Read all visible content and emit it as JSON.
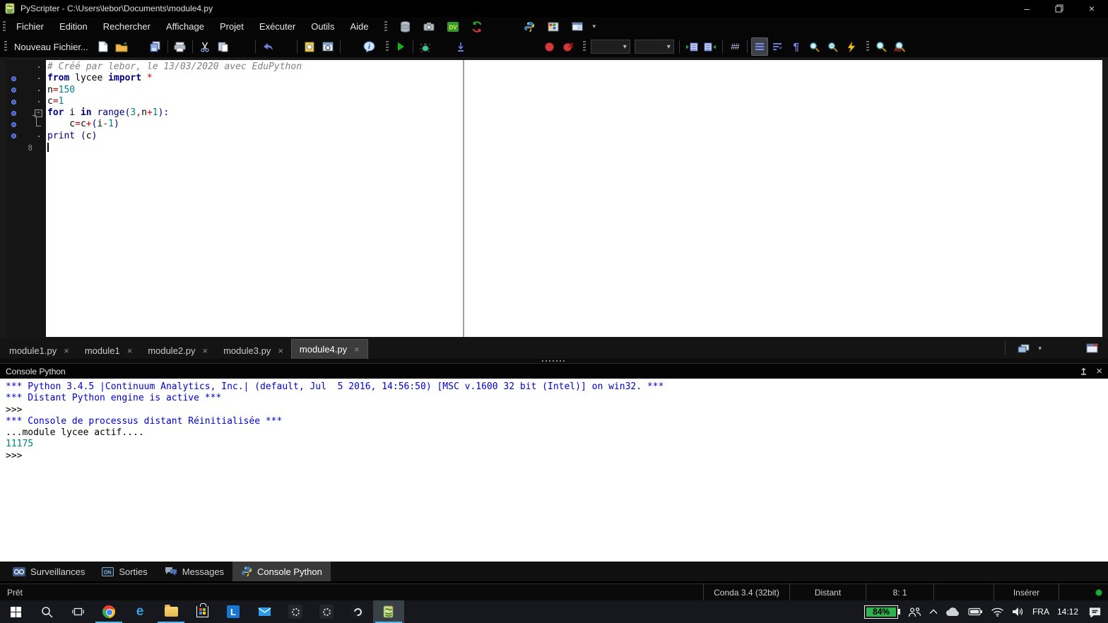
{
  "window": {
    "title": "PyScripter - C:\\Users\\lebor\\Documents\\module4.py"
  },
  "icons": {
    "minimize": "–",
    "close": "×",
    "chevron_down": "▾",
    "pilcrow": "¶",
    "line_numbers": "##"
  },
  "menu_bar": {
    "items": [
      "Fichier",
      "Edition",
      "Rechercher",
      "Affichage",
      "Projet",
      "Exécuter",
      "Outils",
      "Aide"
    ]
  },
  "toolbar": {
    "new_file_label": "Nouveau Fichier..."
  },
  "editor": {
    "lines": [
      {
        "fold": "dot",
        "tokens": [
          {
            "c": "cm",
            "t": "# Créé par lebor, le 13/03/2020 avec EduPython"
          }
        ]
      },
      {
        "mark": true,
        "fold": "dot",
        "tokens": [
          {
            "c": "kw",
            "t": "from"
          },
          {
            "c": "id",
            "t": " lycee "
          },
          {
            "c": "kw",
            "t": "import"
          },
          {
            "c": "op",
            "t": " *"
          }
        ]
      },
      {
        "mark": true,
        "fold": "dot",
        "tokens": [
          {
            "c": "id",
            "t": "n"
          },
          {
            "c": "op",
            "t": "="
          },
          {
            "c": "nm",
            "t": "150"
          }
        ]
      },
      {
        "mark": true,
        "fold": "dot",
        "tokens": [
          {
            "c": "id",
            "t": "c"
          },
          {
            "c": "op",
            "t": "="
          },
          {
            "c": "nm",
            "t": "1"
          }
        ]
      },
      {
        "mark": true,
        "fold": "box",
        "tokens": [
          {
            "c": "kw",
            "t": "for"
          },
          {
            "c": "id",
            "t": " i "
          },
          {
            "c": "kw",
            "t": "in"
          },
          {
            "c": "bi",
            "t": " range"
          },
          {
            "c": "pn",
            "t": "("
          },
          {
            "c": "nm",
            "t": "3"
          },
          {
            "c": "op",
            "t": ","
          },
          {
            "c": "id",
            "t": "n"
          },
          {
            "c": "op",
            "t": "+"
          },
          {
            "c": "nm",
            "t": "1"
          },
          {
            "c": "pn",
            "t": "):"
          }
        ]
      },
      {
        "mark": true,
        "fold": "tail",
        "tokens": [
          {
            "c": "id",
            "t": "    c"
          },
          {
            "c": "op",
            "t": "="
          },
          {
            "c": "id",
            "t": "c"
          },
          {
            "c": "op",
            "t": "+"
          },
          {
            "c": "pn",
            "t": "("
          },
          {
            "c": "id",
            "t": "i"
          },
          {
            "c": "op",
            "t": "-"
          },
          {
            "c": "nm",
            "t": "1"
          },
          {
            "c": "pn",
            "t": ")"
          }
        ]
      },
      {
        "mark": true,
        "fold": "dot",
        "tokens": [
          {
            "c": "bi",
            "t": "print"
          },
          {
            "c": "id",
            "t": " "
          },
          {
            "c": "pn",
            "t": "("
          },
          {
            "c": "id",
            "t": "c"
          },
          {
            "c": "pn",
            "t": ")"
          }
        ]
      },
      {
        "num": "8",
        "caret": true,
        "tokens": []
      }
    ]
  },
  "editor_tabs": [
    {
      "label": "module1.py",
      "active": false
    },
    {
      "label": "module1",
      "active": false
    },
    {
      "label": "module2.py",
      "active": false
    },
    {
      "label": "module3.py",
      "active": false
    },
    {
      "label": "module4.py",
      "active": true
    }
  ],
  "console": {
    "title": "Console Python",
    "lines": [
      {
        "color": "blue",
        "text": "*** Python 3.4.5 |Continuum Analytics, Inc.| (default, Jul  5 2016, 14:56:50) [MSC v.1600 32 bit (Intel)] on win32. ***"
      },
      {
        "color": "blue",
        "text": "*** Distant Python engine is active ***"
      },
      {
        "color": "black",
        "text": ">>>"
      },
      {
        "color": "blue",
        "text": "*** Console de processus distant Réinitialisée ***"
      },
      {
        "color": "black",
        "text": "...module lycee actif...."
      },
      {
        "color": "teal",
        "text": "11175"
      },
      {
        "color": "black",
        "text": ">>>"
      }
    ]
  },
  "dock_tabs": [
    {
      "label": "Surveillances"
    },
    {
      "label": "Sorties"
    },
    {
      "label": "Messages"
    },
    {
      "label": "Console Python"
    }
  ],
  "status_bar": {
    "ready": "Prêt",
    "conda": "Conda 3.4 (32bit)",
    "engine": "Distant",
    "caret_pos": "8: 1",
    "insert_mode": "Insérer"
  },
  "taskbar": {
    "battery_percent": "84%",
    "language": "FRA",
    "time": "14:12"
  },
  "colors": {
    "console_blue": "#0000d4",
    "number_teal": "#008080",
    "keyword_navy": "#000080",
    "operator_red": "#c00000",
    "comment_gray": "#808080",
    "run_green": "#18b418",
    "breakpoint_red": "#d43b3b",
    "battery_green": "#2fb34f",
    "taskbar_accent": "#4fb8f0"
  }
}
